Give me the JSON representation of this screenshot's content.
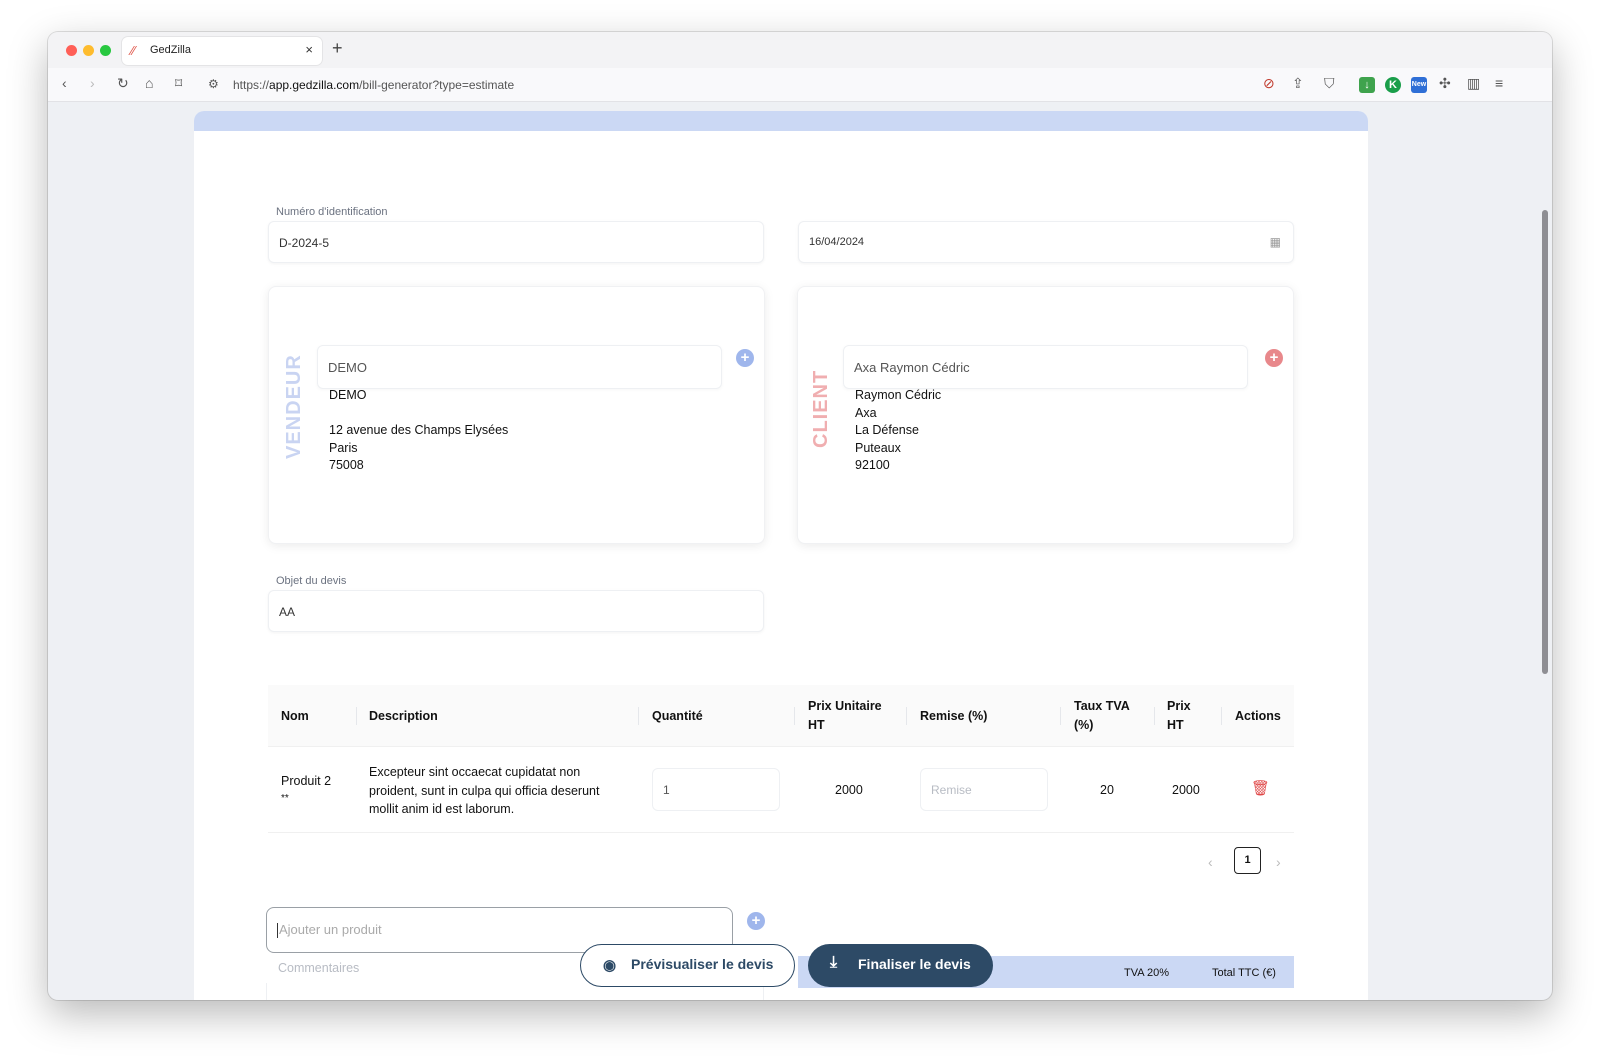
{
  "browser": {
    "tab_title": "GedZilla",
    "url_scheme": "https://",
    "url_domain": "app.gedzilla.com",
    "url_path": "/bill-generator?type=estimate",
    "new_badge": "New"
  },
  "form": {
    "id_label": "Numéro d'identification",
    "id_value": "D-2024-5",
    "date_value": "16/04/2024",
    "object_label": "Objet du devis",
    "object_value": "AA"
  },
  "vendor": {
    "section_label": "VENDEUR",
    "select_value": "DEMO",
    "address": "DEMO\n\n12 avenue des Champs Elysées\nParis\n75008"
  },
  "client": {
    "section_label": "CLIENT",
    "select_value": "Axa Raymon Cédric",
    "address": "Raymon Cédric\nAxa\nLa Défense\nPuteaux\n92100"
  },
  "table": {
    "headers": {
      "nom": "Nom",
      "description": "Description",
      "quantite": "Quantité",
      "prix_unitaire": "Prix Unitaire\nHT",
      "remise": "Remise (%)",
      "taux_tva": "Taux TVA\n(%)",
      "prix_ht": "Prix\nHT",
      "actions": "Actions"
    },
    "rows": [
      {
        "nom": "Produit 2",
        "nom_sub": "**",
        "description": "Excepteur sint occaecat cupidatat non proident, sunt in culpa qui officia deserunt mollit anim id est laborum.",
        "quantite": "1",
        "prix_unitaire": "2000",
        "remise_placeholder": "Remise",
        "taux_tva": "20",
        "prix_ht": "2000"
      }
    ]
  },
  "pagination": {
    "current_page": "1"
  },
  "add_product_placeholder": "Ajouter un produit",
  "comments_placeholder": "Commentaires",
  "totals": {
    "tva_label": "TVA 20%",
    "total_label": "Total TTC (€)"
  },
  "buttons": {
    "preview": "Prévisualiser le devis",
    "finalize": "Finaliser le devis"
  },
  "colors": {
    "primary": "#2d4a66",
    "vendor_accent": "#9fb6ec",
    "client_accent": "#e8888b",
    "band": "#cbd8f4",
    "danger": "#e04848"
  }
}
